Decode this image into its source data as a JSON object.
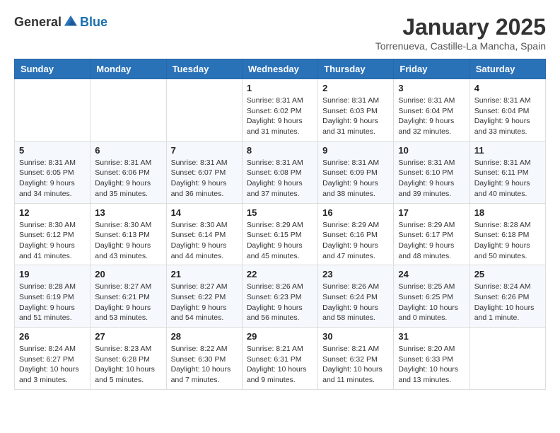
{
  "header": {
    "logo_general": "General",
    "logo_blue": "Blue",
    "month_title": "January 2025",
    "subtitle": "Torrenueva, Castille-La Mancha, Spain"
  },
  "weekdays": [
    "Sunday",
    "Monday",
    "Tuesday",
    "Wednesday",
    "Thursday",
    "Friday",
    "Saturday"
  ],
  "weeks": [
    [
      {
        "day": "",
        "sunrise": "",
        "sunset": "",
        "daylight": ""
      },
      {
        "day": "",
        "sunrise": "",
        "sunset": "",
        "daylight": ""
      },
      {
        "day": "",
        "sunrise": "",
        "sunset": "",
        "daylight": ""
      },
      {
        "day": "1",
        "sunrise": "Sunrise: 8:31 AM",
        "sunset": "Sunset: 6:02 PM",
        "daylight": "Daylight: 9 hours and 31 minutes."
      },
      {
        "day": "2",
        "sunrise": "Sunrise: 8:31 AM",
        "sunset": "Sunset: 6:03 PM",
        "daylight": "Daylight: 9 hours and 31 minutes."
      },
      {
        "day": "3",
        "sunrise": "Sunrise: 8:31 AM",
        "sunset": "Sunset: 6:04 PM",
        "daylight": "Daylight: 9 hours and 32 minutes."
      },
      {
        "day": "4",
        "sunrise": "Sunrise: 8:31 AM",
        "sunset": "Sunset: 6:04 PM",
        "daylight": "Daylight: 9 hours and 33 minutes."
      }
    ],
    [
      {
        "day": "5",
        "sunrise": "Sunrise: 8:31 AM",
        "sunset": "Sunset: 6:05 PM",
        "daylight": "Daylight: 9 hours and 34 minutes."
      },
      {
        "day": "6",
        "sunrise": "Sunrise: 8:31 AM",
        "sunset": "Sunset: 6:06 PM",
        "daylight": "Daylight: 9 hours and 35 minutes."
      },
      {
        "day": "7",
        "sunrise": "Sunrise: 8:31 AM",
        "sunset": "Sunset: 6:07 PM",
        "daylight": "Daylight: 9 hours and 36 minutes."
      },
      {
        "day": "8",
        "sunrise": "Sunrise: 8:31 AM",
        "sunset": "Sunset: 6:08 PM",
        "daylight": "Daylight: 9 hours and 37 minutes."
      },
      {
        "day": "9",
        "sunrise": "Sunrise: 8:31 AM",
        "sunset": "Sunset: 6:09 PM",
        "daylight": "Daylight: 9 hours and 38 minutes."
      },
      {
        "day": "10",
        "sunrise": "Sunrise: 8:31 AM",
        "sunset": "Sunset: 6:10 PM",
        "daylight": "Daylight: 9 hours and 39 minutes."
      },
      {
        "day": "11",
        "sunrise": "Sunrise: 8:31 AM",
        "sunset": "Sunset: 6:11 PM",
        "daylight": "Daylight: 9 hours and 40 minutes."
      }
    ],
    [
      {
        "day": "12",
        "sunrise": "Sunrise: 8:30 AM",
        "sunset": "Sunset: 6:12 PM",
        "daylight": "Daylight: 9 hours and 41 minutes."
      },
      {
        "day": "13",
        "sunrise": "Sunrise: 8:30 AM",
        "sunset": "Sunset: 6:13 PM",
        "daylight": "Daylight: 9 hours and 43 minutes."
      },
      {
        "day": "14",
        "sunrise": "Sunrise: 8:30 AM",
        "sunset": "Sunset: 6:14 PM",
        "daylight": "Daylight: 9 hours and 44 minutes."
      },
      {
        "day": "15",
        "sunrise": "Sunrise: 8:29 AM",
        "sunset": "Sunset: 6:15 PM",
        "daylight": "Daylight: 9 hours and 45 minutes."
      },
      {
        "day": "16",
        "sunrise": "Sunrise: 8:29 AM",
        "sunset": "Sunset: 6:16 PM",
        "daylight": "Daylight: 9 hours and 47 minutes."
      },
      {
        "day": "17",
        "sunrise": "Sunrise: 8:29 AM",
        "sunset": "Sunset: 6:17 PM",
        "daylight": "Daylight: 9 hours and 48 minutes."
      },
      {
        "day": "18",
        "sunrise": "Sunrise: 8:28 AM",
        "sunset": "Sunset: 6:18 PM",
        "daylight": "Daylight: 9 hours and 50 minutes."
      }
    ],
    [
      {
        "day": "19",
        "sunrise": "Sunrise: 8:28 AM",
        "sunset": "Sunset: 6:19 PM",
        "daylight": "Daylight: 9 hours and 51 minutes."
      },
      {
        "day": "20",
        "sunrise": "Sunrise: 8:27 AM",
        "sunset": "Sunset: 6:21 PM",
        "daylight": "Daylight: 9 hours and 53 minutes."
      },
      {
        "day": "21",
        "sunrise": "Sunrise: 8:27 AM",
        "sunset": "Sunset: 6:22 PM",
        "daylight": "Daylight: 9 hours and 54 minutes."
      },
      {
        "day": "22",
        "sunrise": "Sunrise: 8:26 AM",
        "sunset": "Sunset: 6:23 PM",
        "daylight": "Daylight: 9 hours and 56 minutes."
      },
      {
        "day": "23",
        "sunrise": "Sunrise: 8:26 AM",
        "sunset": "Sunset: 6:24 PM",
        "daylight": "Daylight: 9 hours and 58 minutes."
      },
      {
        "day": "24",
        "sunrise": "Sunrise: 8:25 AM",
        "sunset": "Sunset: 6:25 PM",
        "daylight": "Daylight: 10 hours and 0 minutes."
      },
      {
        "day": "25",
        "sunrise": "Sunrise: 8:24 AM",
        "sunset": "Sunset: 6:26 PM",
        "daylight": "Daylight: 10 hours and 1 minute."
      }
    ],
    [
      {
        "day": "26",
        "sunrise": "Sunrise: 8:24 AM",
        "sunset": "Sunset: 6:27 PM",
        "daylight": "Daylight: 10 hours and 3 minutes."
      },
      {
        "day": "27",
        "sunrise": "Sunrise: 8:23 AM",
        "sunset": "Sunset: 6:28 PM",
        "daylight": "Daylight: 10 hours and 5 minutes."
      },
      {
        "day": "28",
        "sunrise": "Sunrise: 8:22 AM",
        "sunset": "Sunset: 6:30 PM",
        "daylight": "Daylight: 10 hours and 7 minutes."
      },
      {
        "day": "29",
        "sunrise": "Sunrise: 8:21 AM",
        "sunset": "Sunset: 6:31 PM",
        "daylight": "Daylight: 10 hours and 9 minutes."
      },
      {
        "day": "30",
        "sunrise": "Sunrise: 8:21 AM",
        "sunset": "Sunset: 6:32 PM",
        "daylight": "Daylight: 10 hours and 11 minutes."
      },
      {
        "day": "31",
        "sunrise": "Sunrise: 8:20 AM",
        "sunset": "Sunset: 6:33 PM",
        "daylight": "Daylight: 10 hours and 13 minutes."
      },
      {
        "day": "",
        "sunrise": "",
        "sunset": "",
        "daylight": ""
      }
    ]
  ]
}
